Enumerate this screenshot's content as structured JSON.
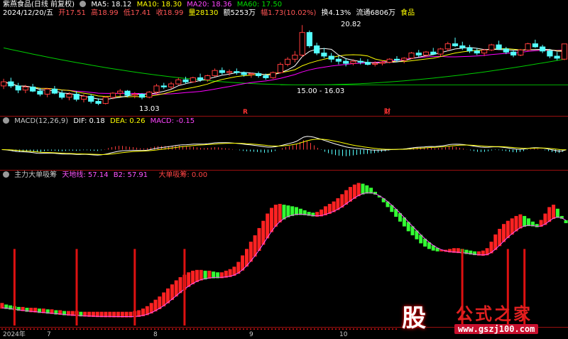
{
  "header": {
    "stock_name": "紫燕食品(日线 前复权)",
    "ma5_label": "MA5: 18.12",
    "ma10_label": "MA10: 18.30",
    "ma20_label": "MA20: 18.36",
    "ma60_label": "MA60: 17.50",
    "date_label": "2024/12/20/五",
    "open_label": "开17.51",
    "high_label": "高18.99",
    "low_label": "低17.41",
    "close_label": "收18.99",
    "volume_label": "量28130",
    "amount_label": "额5253万",
    "change_label": "幅1.73(10.02%)",
    "turnover_label": "换4.13%",
    "float_label": "流通6806万",
    "industry_label": "食品"
  },
  "macd_header": {
    "title": "MACD(12,26,9)",
    "dif_label": "DIF: 0.18",
    "dea_label": "DEA: 0.26",
    "macd_label": "MACD: -0.15"
  },
  "ind_header": {
    "title": "主力大单吸筹",
    "tian_label": "天地线: 57.14",
    "b2_label": "B2: 57.91",
    "big_label": "大单吸筹: 0.00"
  },
  "annotations": {
    "high_price": "20.82",
    "low_price": "13.03",
    "range_price": "15.00 - 16.03",
    "marker_r": "R",
    "marker_cai": "财"
  },
  "x_axis": {
    "labels": [
      "2024年",
      "7",
      "8",
      "9",
      "10"
    ]
  },
  "watermark": {
    "gu": "股",
    "name": "公式之家",
    "url": "www.gszj100.com"
  },
  "colors": {
    "up": "#ff3c3c",
    "down": "#54ffff",
    "ma5": "#ffffff",
    "ma10": "#ffff00",
    "ma20": "#ff00ff",
    "ma60": "#00cc00",
    "ind_up": "#ff2222",
    "ind_down": "#33ff33",
    "b2_line": "#ff55ff",
    "spike": "#dd1111"
  },
  "chart_data": [
    {
      "type": "candlestick",
      "title": "紫燕食品(日线 前复权)",
      "ohlc": [
        [
          14.9,
          15.6,
          14.6,
          15.3
        ],
        [
          15.3,
          15.7,
          14.7,
          14.9
        ],
        [
          14.9,
          15.2,
          14.2,
          14.5
        ],
        [
          14.5,
          15,
          14.2,
          14.8
        ],
        [
          14.8,
          15.1,
          14.3,
          14.4
        ],
        [
          14.4,
          14.7,
          13.9,
          14.1
        ],
        [
          14.1,
          14.7,
          13.8,
          14.6
        ],
        [
          14.6,
          14.9,
          14.1,
          14.2
        ],
        [
          14.2,
          14.5,
          13.6,
          13.8
        ],
        [
          13.8,
          14.3,
          13.5,
          14.1
        ],
        [
          14.1,
          14.4,
          13.4,
          13.6
        ],
        [
          13.6,
          14.1,
          13.3,
          13.9
        ],
        [
          13.9,
          14.1,
          13.2,
          13.4
        ],
        [
          13.4,
          13.7,
          13.03,
          13.2
        ],
        [
          13.2,
          13.9,
          13.1,
          13.8
        ],
        [
          13.8,
          14.3,
          13.6,
          14.2
        ],
        [
          14.2,
          14.6,
          13.9,
          14.4
        ],
        [
          14.4,
          14.5,
          13.8,
          14
        ],
        [
          14,
          14.3,
          13.7,
          14.1
        ],
        [
          14.1,
          14.2,
          13.6,
          13.8
        ],
        [
          13.8,
          14.4,
          13.7,
          14.3
        ],
        [
          14.3,
          15.1,
          14.1,
          14.9
        ],
        [
          14.9,
          15.2,
          14.6,
          14.8
        ],
        [
          14.8,
          15.3,
          14.6,
          15.1
        ],
        [
          15.1,
          15.7,
          15,
          15.5
        ],
        [
          15.5,
          15.8,
          15.1,
          15.3
        ],
        [
          15.3,
          15.8,
          15.2,
          15.7
        ],
        [
          15.7,
          16.1,
          15.3,
          15.5
        ],
        [
          15.5,
          16,
          15.3,
          15.9
        ],
        [
          15.9,
          16.6,
          15.8,
          16.4
        ],
        [
          16.4,
          16.7,
          16,
          16.2
        ],
        [
          16.2,
          16.5,
          15.9,
          16.3
        ],
        [
          16.3,
          16.6,
          16,
          16.2
        ],
        [
          16.2,
          16.3,
          15.8,
          16
        ],
        [
          16,
          16.2,
          15.7,
          16.1
        ],
        [
          16.1,
          16.3,
          15.7,
          15.9
        ],
        [
          15.9,
          16.1,
          15.5,
          15.7
        ],
        [
          15.7,
          16.3,
          15.6,
          16.2
        ],
        [
          16.2,
          17.2,
          16.1,
          17
        ],
        [
          17,
          17.7,
          16.8,
          17.5
        ],
        [
          17.5,
          18.3,
          17.2,
          17.9
        ],
        [
          17.9,
          20.82,
          17.7,
          20.1
        ],
        [
          20.1,
          20.3,
          18.6,
          18.8
        ],
        [
          18.8,
          19.1,
          17.9,
          18.1
        ],
        [
          18.1,
          18.6,
          17.6,
          17.8
        ],
        [
          17.8,
          18.1,
          17.2,
          17.5
        ],
        [
          17.5,
          17.8,
          17,
          17.3
        ],
        [
          17.3,
          17.6,
          16.8,
          17.1
        ],
        [
          17.1,
          17.5,
          16.9,
          17.3
        ],
        [
          17.3,
          17.6,
          17,
          17.2
        ],
        [
          17.2,
          17.5,
          16.9,
          17
        ],
        [
          17,
          17.3,
          16.8,
          17.1
        ],
        [
          17.1,
          17.4,
          16.9,
          17.2
        ],
        [
          17.2,
          17.6,
          17.1,
          17.5
        ],
        [
          17.5,
          17.8,
          17.2,
          17.4
        ],
        [
          17.4,
          17.7,
          17.1,
          17.6
        ],
        [
          17.6,
          18.2,
          17.5,
          18.1
        ],
        [
          18.1,
          18.4,
          17.7,
          17.9
        ],
        [
          17.9,
          18.3,
          17.7,
          18.2
        ],
        [
          18.2,
          18.6,
          17.9,
          18
        ],
        [
          18,
          18.6,
          17.8,
          18.5
        ],
        [
          18.5,
          19.2,
          18.3,
          19
        ],
        [
          19,
          19.6,
          18.7,
          18.8
        ],
        [
          18.8,
          19.2,
          18.4,
          18.6
        ],
        [
          18.6,
          18.9,
          18.1,
          18.3
        ],
        [
          18.3,
          18.6,
          17.9,
          18.1
        ],
        [
          18.1,
          18.5,
          17.8,
          18.4
        ],
        [
          18.4,
          19,
          18.3,
          18.9
        ],
        [
          18.9,
          19.3,
          18.4,
          18.5
        ],
        [
          18.5,
          18.7,
          18,
          18.2
        ],
        [
          18.2,
          18.4,
          17.7,
          17.9
        ],
        [
          17.9,
          18.5,
          17.8,
          18.4
        ],
        [
          18.4,
          19.1,
          18.3,
          19
        ],
        [
          19,
          19.4,
          18.6,
          18.7
        ],
        [
          18.7,
          18.9,
          18.1,
          18.3
        ],
        [
          18.3,
          18.5,
          17.6,
          17.8
        ],
        [
          17.8,
          18.2,
          17.4,
          17.6
        ],
        [
          17.51,
          18.99,
          17.41,
          18.99
        ]
      ],
      "ma60_level": 15.2,
      "y_range": [
        12.2,
        21.6
      ],
      "annotations": {
        "high": 20.82,
        "low": 13.03,
        "range": [
          15.0,
          16.03
        ]
      }
    },
    {
      "type": "bar",
      "title": "MACD(12,26,9)",
      "dif": 0.18,
      "dea": 0.26,
      "macd": -0.15,
      "hist_up": [
        0.6,
        0.7,
        0.8,
        0.8,
        0.9,
        0.8,
        0.7,
        0.6,
        0.5,
        0.5
      ],
      "hist_down": [
        0.5,
        0.6,
        0.7,
        0.7,
        0.8,
        0.6,
        0.5,
        0.4,
        0.3,
        0.3
      ],
      "y_range": [
        -1.5,
        1.5
      ]
    },
    {
      "type": "bar",
      "title": "主力大单吸筹",
      "tiandi": 57.14,
      "b2": 57.91,
      "big_order": 0.0,
      "values": [
        28,
        26,
        25,
        24,
        23,
        23,
        22,
        22,
        22,
        21,
        21,
        20,
        20,
        19,
        19,
        18,
        18,
        18,
        18,
        17,
        17,
        17,
        17,
        17,
        17,
        17,
        17,
        17,
        17,
        17,
        17,
        17,
        18,
        19,
        21,
        24,
        28,
        32,
        36,
        41,
        46,
        51,
        56,
        60,
        63,
        66,
        68,
        69,
        69,
        68,
        68,
        67,
        66,
        66,
        68,
        70,
        73,
        79,
        87,
        95,
        104,
        112,
        121,
        130,
        139,
        146,
        150,
        151,
        150,
        149,
        148,
        147,
        145,
        143,
        141,
        140,
        141,
        144,
        148,
        151,
        154,
        158,
        163,
        168,
        172,
        175,
        177,
        176,
        174,
        171,
        166,
        160,
        154,
        148,
        142,
        136,
        130,
        124,
        118,
        113,
        108,
        103,
        99,
        96,
        94,
        93,
        93,
        94,
        95,
        96,
        96,
        95,
        94,
        93,
        92,
        92,
        93,
        96,
        104,
        113,
        120,
        126,
        130,
        133,
        136,
        138,
        136,
        133,
        129,
        126,
        131,
        139,
        147,
        150,
        145,
        136,
        128
      ],
      "spikes": [
        {
          "index": 3,
          "value": 95
        },
        {
          "index": 18,
          "value": 95
        },
        {
          "index": 32,
          "value": 95
        },
        {
          "index": 44,
          "value": 95
        },
        {
          "index": 111,
          "value": 95
        },
        {
          "index": 122,
          "value": 95
        },
        {
          "index": 126,
          "value": 95
        },
        {
          "index": 138,
          "value": 95
        }
      ],
      "y_range": [
        0,
        180
      ]
    }
  ]
}
